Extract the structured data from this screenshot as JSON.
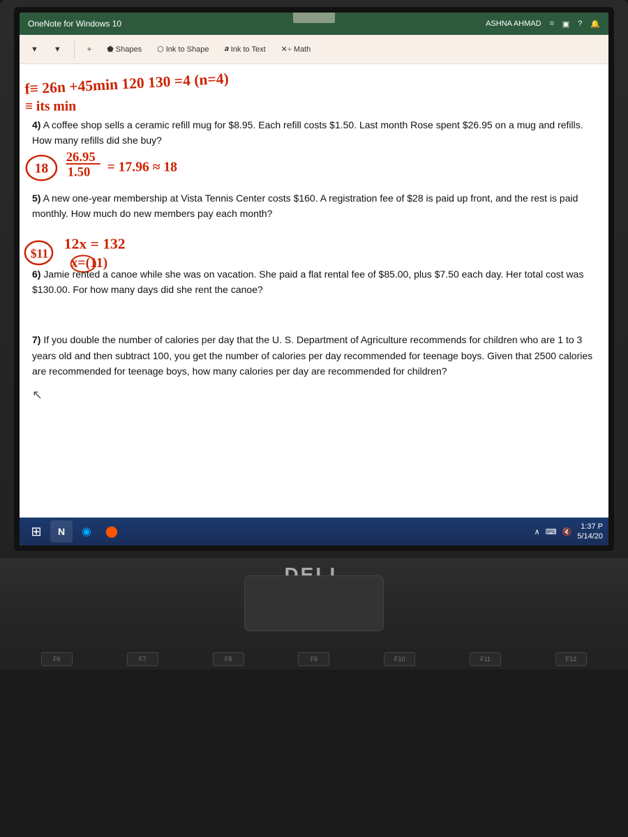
{
  "window": {
    "title": "OneNote for Windows 10",
    "user": "ASHNA AHMAD"
  },
  "toolbar": {
    "shapes_label": "Shapes",
    "ink_to_shape_label": "Ink to Shape",
    "ink_to_text_label": "Ink to Text",
    "math_label": "Math"
  },
  "problems": [
    {
      "number": "4)",
      "text": "A coffee shop sells a ceramic refill mug for $8.95. Each refill costs $1.50. Last month Rose spent $26.95 on a mug and refills. How many refills did she buy?"
    },
    {
      "number": "5)",
      "text": "A new one-year membership at Vista Tennis Center costs $160. A registration fee of $28 is paid up front, and the rest is paid monthly. How much do new members pay each month?"
    },
    {
      "number": "6)",
      "text": "Jamie rented a canoe while she was on vacation. She paid a flat rental fee of $85.00, plus $7.50 each day. Her total cost was $130.00. For how many days did she rent the canoe?"
    },
    {
      "number": "7)",
      "text": "If you double the number of calories per day that the U. S. Department of Agriculture recommends for children who are 1 to 3 years old and then subtract 100, you get the number of calories per day recommended for teenage boys. Given that 2500 calories are recommended for teenage boys, how many calories per day are recommended for children?"
    }
  ],
  "taskbar": {
    "time": "1:37 P",
    "date": "5/14/20",
    "icons": [
      "⊞",
      "N",
      "◉",
      "⬤"
    ]
  },
  "keyboard": {
    "keys": [
      "F6",
      "F7",
      "F8",
      "F9",
      "F10",
      "F11",
      "F12"
    ]
  },
  "dell_logo": "DELL",
  "system_icons": {
    "expand": "⌗",
    "display": "▣",
    "help": "?",
    "bell": "🔔"
  }
}
